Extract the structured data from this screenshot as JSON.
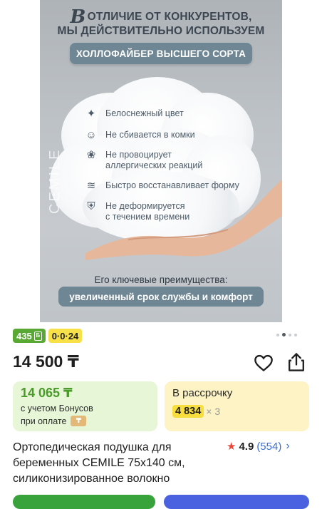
{
  "gallery": {
    "headline_initial": "В",
    "headline_line1": "ОТЛИЧИЕ ОТ КОНКУРЕНТОВ,",
    "headline_line2": "МЫ ДЕЙСТВИТЕЛЬНО ИСПОЛЬЗУЕМ",
    "pill_top": "ХОЛЛОФАЙБЕР ВЫСШЕГО СОРТА",
    "features": [
      {
        "icon": "sparkle-icon",
        "text": "Белоснежный цвет"
      },
      {
        "icon": "smile-icon",
        "text": "Не сбивается в комки"
      },
      {
        "icon": "allergy-icon",
        "text": "Не провоцирует\nаллергических реакций"
      },
      {
        "icon": "spring-icon",
        "text": "Быстро восстанавливает форму"
      },
      {
        "icon": "shield-check-icon",
        "text": "Не деформируется\nс течением времени"
      }
    ],
    "brand_watermark": "CEMILE",
    "advantages_label": "Его ключевые преимущества:",
    "pill_bottom": "увеличенный срок службы и комфорт",
    "page_dots": {
      "count": 4,
      "active_index": 1
    }
  },
  "badges": {
    "bonus_count": "435",
    "timer": "0·0·24"
  },
  "price": {
    "current": "14 500 ₸"
  },
  "bonus_card": {
    "amount": "14 065 ₸",
    "line1": "с учетом Бонусов",
    "line2": "при оплате"
  },
  "installment_card": {
    "title": "В рассрочку",
    "monthly": "4 834",
    "multiplier": "× 3"
  },
  "product": {
    "title": "Ортопедическая подушка для беременных CEMILE 75x140 см, силиконизированное волокно",
    "rating_star": "★",
    "rating": "4.9",
    "reviews": "(554)",
    "chevron": "›"
  },
  "colors": {
    "accent_green": "#5aa834",
    "accent_blue": "#3b6fd4",
    "rating_red": "#e8473c"
  }
}
